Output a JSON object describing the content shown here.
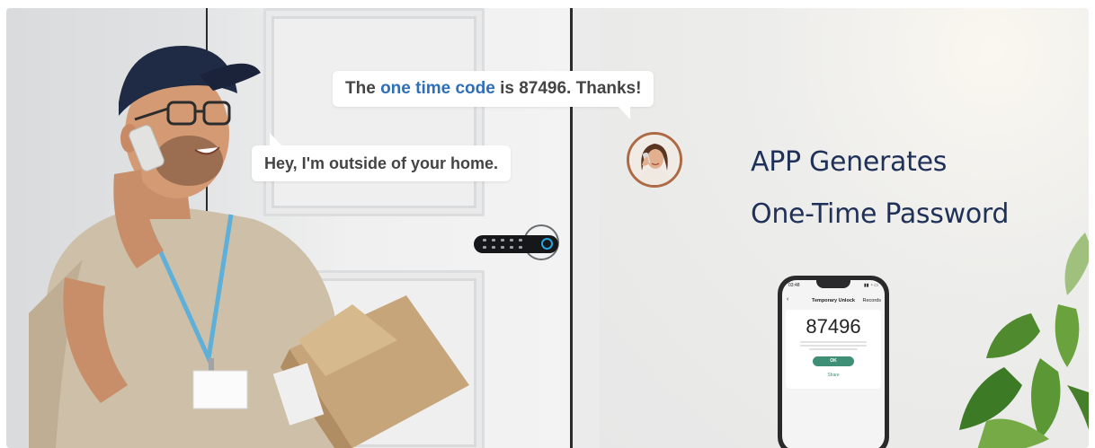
{
  "speech": {
    "code_message": {
      "part1": "The ",
      "highlight": "one time code",
      "part2": " is 87496. Thanks!"
    },
    "outside_message": "Hey, I'm outside of your home."
  },
  "headline": {
    "line1": "APP Generates",
    "line2": "One-Time Password"
  },
  "phone": {
    "status_time": "03:48",
    "title": "Temporary Unlock",
    "records": "Records",
    "back": "‹",
    "code": "87496",
    "ok_label": "OK",
    "share_label": "Share"
  },
  "colors": {
    "highlight_blue": "#2f6fb8",
    "headline_navy": "#1f3158",
    "ok_green": "#3e8f76",
    "fingerprint_blue": "#27a3e0"
  }
}
